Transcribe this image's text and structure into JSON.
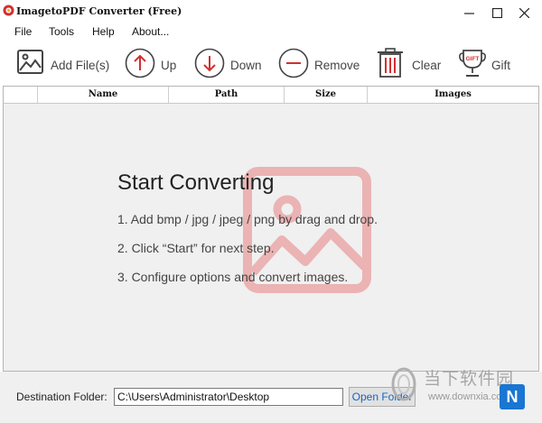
{
  "window": {
    "title": "ImagetoPDF Converter (Free)"
  },
  "menu": [
    {
      "label": "File"
    },
    {
      "label": "Tools"
    },
    {
      "label": "Help"
    },
    {
      "label": "About..."
    }
  ],
  "toolbar": {
    "add_files": "Add File(s)",
    "up": "Up",
    "down": "Down",
    "remove": "Remove",
    "clear": "Clear",
    "gift": "Gift",
    "gift_badge": "GIFT"
  },
  "table": {
    "columns": [
      "Name",
      "Path",
      "Size",
      "Images"
    ]
  },
  "empty_state": {
    "title": "Start Converting",
    "steps": [
      "1. Add bmp / jpg / jpeg / png by drag and drop.",
      "2. Click “Start” for next step.",
      "3. Configure options and convert images."
    ]
  },
  "footer": {
    "destination_label": "Destination Folder:",
    "destination_value": "C:\\Users\\Administrator\\Desktop",
    "open_folder": "Open Folder"
  },
  "watermark": {
    "text": "当下软件园",
    "url": "www.downxia.com",
    "logo_letter": "N"
  },
  "colors": {
    "accent_red": "#d32f2f",
    "art_pink": "#e8a0a0",
    "link_blue": "#1565c0"
  }
}
